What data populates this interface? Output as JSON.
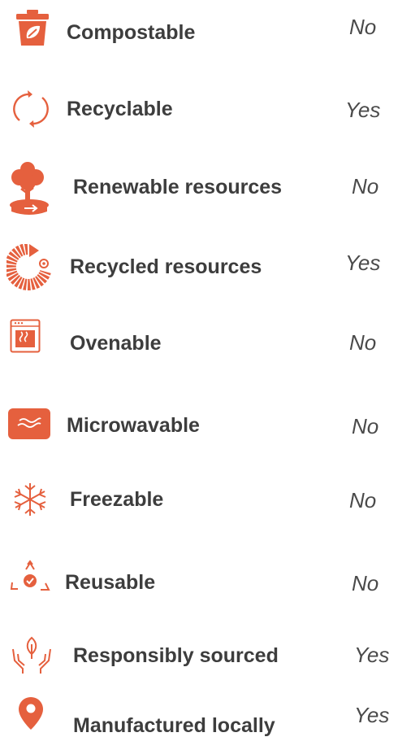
{
  "colors": {
    "accent": "#e5603e",
    "text": "#3d3d3d",
    "value_text": "#4a4a4a"
  },
  "items": [
    {
      "icon": "compost-bin-icon",
      "label": "Compostable",
      "value": "No"
    },
    {
      "icon": "recycle-arrows-icon",
      "label": "Recyclable",
      "value": "Yes"
    },
    {
      "icon": "tree-icon",
      "label": "Renewable resources",
      "value": "No"
    },
    {
      "icon": "recycled-resources-icon",
      "label": "Recycled resources",
      "value": "Yes"
    },
    {
      "icon": "oven-icon",
      "label": "Ovenable",
      "value": "No"
    },
    {
      "icon": "microwave-icon",
      "label": "Microwavable",
      "value": "No"
    },
    {
      "icon": "snowflake-icon",
      "label": "Freezable",
      "value": "No"
    },
    {
      "icon": "reusable-icon",
      "label": "Reusable",
      "value": "No"
    },
    {
      "icon": "hands-leaf-icon",
      "label": "Responsibly sourced",
      "value": "Yes"
    },
    {
      "icon": "location-pin-icon",
      "label": "Manufactured locally",
      "value": "Yes"
    }
  ]
}
